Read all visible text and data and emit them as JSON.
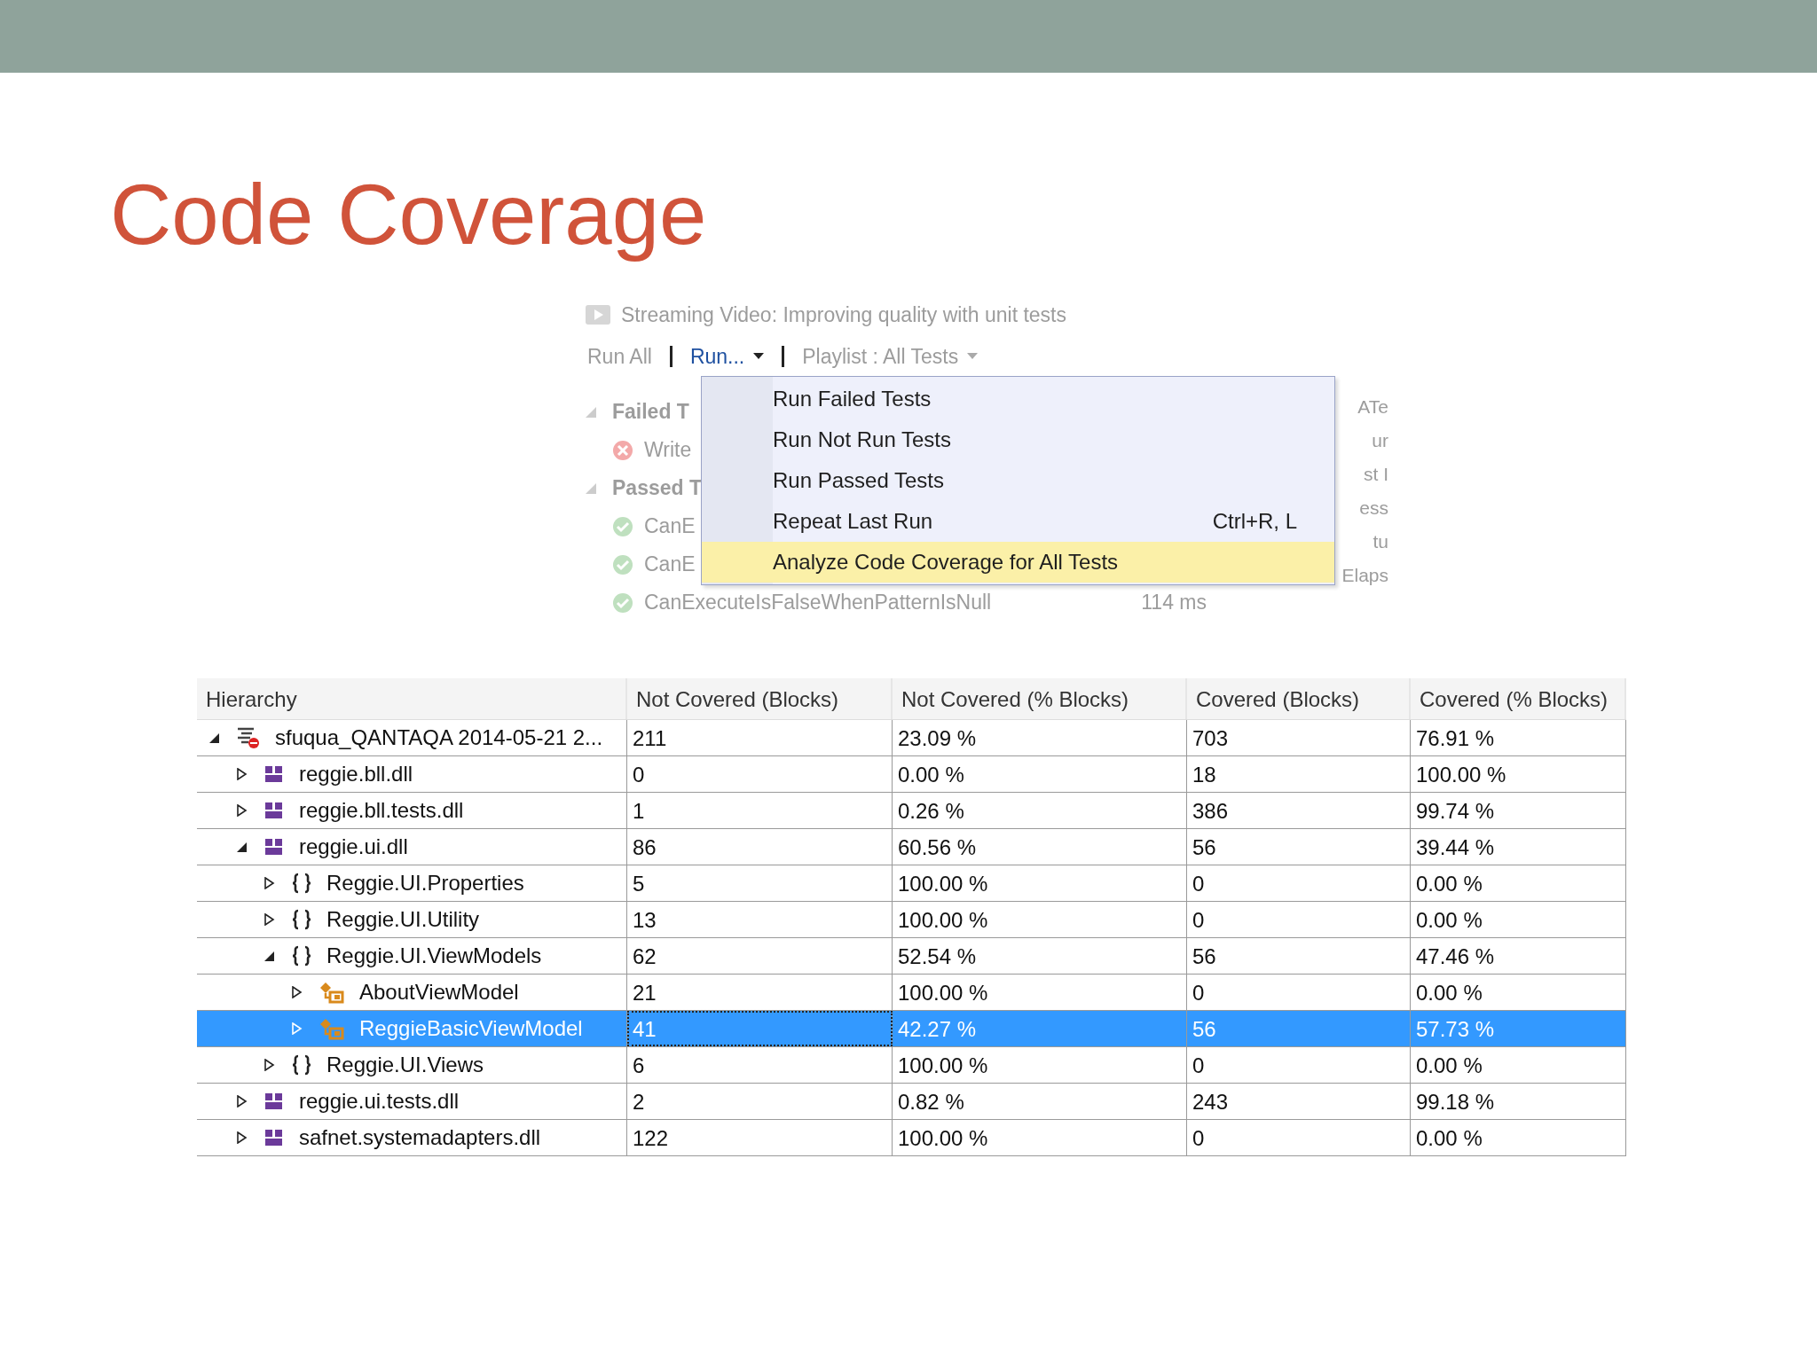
{
  "title": "Code Coverage",
  "test_explorer": {
    "video_title": "Streaming Video: Improving quality with unit tests",
    "toolbar": [
      {
        "label": "Run All",
        "kind": "faded"
      },
      {
        "label": "Run...",
        "kind": "dropdown-active"
      },
      {
        "label": "Playlist : All Tests",
        "kind": "dropdown-faded"
      }
    ],
    "tree": [
      {
        "label": "Failed T",
        "kind": "group"
      },
      {
        "label": "Write",
        "kind": "failed"
      },
      {
        "label": "Passed T",
        "kind": "group"
      },
      {
        "label": "CanE",
        "kind": "passed"
      },
      {
        "label": "CanE",
        "kind": "passed"
      },
      {
        "label": "CanExecuteIsFalseWhenPatternIsNull",
        "kind": "passed",
        "time": "114 ms"
      }
    ],
    "side_fragments": [
      "ATe",
      "ur",
      "st I",
      "ess",
      "tu",
      "Elaps"
    ]
  },
  "menu": {
    "items": [
      {
        "label": "Run Failed Tests",
        "selected": false
      },
      {
        "label": "Run Not Run Tests",
        "selected": false
      },
      {
        "label": "Run Passed Tests",
        "selected": false
      },
      {
        "label": "Repeat Last Run",
        "shortcut": "Ctrl+R, L",
        "selected": false
      },
      {
        "label": "Analyze Code Coverage for All Tests",
        "selected": true
      }
    ]
  },
  "coverage": {
    "columns": [
      "Hierarchy",
      "Not Covered (Blocks)",
      "Not Covered (% Blocks)",
      "Covered (Blocks)",
      "Covered (% Blocks)"
    ],
    "rows": [
      {
        "kind": "run",
        "name": "sfuqua_QANTAQA 2014-05-21 2...",
        "values": [
          "211",
          "23.09 %",
          "703",
          "76.91 %"
        ],
        "expanded": true,
        "selected": false,
        "children": [
          {
            "kind": "assembly",
            "name": "reggie.bll.dll",
            "values": [
              "0",
              "0.00 %",
              "18",
              "100.00 %"
            ],
            "expanded": false,
            "selected": false
          },
          {
            "kind": "assembly",
            "name": "reggie.bll.tests.dll",
            "values": [
              "1",
              "0.26 %",
              "386",
              "99.74 %"
            ],
            "expanded": false,
            "selected": false
          },
          {
            "kind": "assembly",
            "name": "reggie.ui.dll",
            "values": [
              "86",
              "60.56 %",
              "56",
              "39.44 %"
            ],
            "expanded": true,
            "selected": false,
            "children": [
              {
                "kind": "namespace",
                "name": "Reggie.UI.Properties",
                "values": [
                  "5",
                  "100.00 %",
                  "0",
                  "0.00 %"
                ],
                "expanded": false,
                "selected": false
              },
              {
                "kind": "namespace",
                "name": "Reggie.UI.Utility",
                "values": [
                  "13",
                  "100.00 %",
                  "0",
                  "0.00 %"
                ],
                "expanded": false,
                "selected": false
              },
              {
                "kind": "namespace",
                "name": "Reggie.UI.ViewModels",
                "values": [
                  "62",
                  "52.54 %",
                  "56",
                  "47.46 %"
                ],
                "expanded": true,
                "selected": false,
                "children": [
                  {
                    "kind": "class",
                    "name": "AboutViewModel",
                    "values": [
                      "21",
                      "100.00 %",
                      "0",
                      "0.00 %"
                    ],
                    "expanded": false,
                    "selected": false
                  },
                  {
                    "kind": "class",
                    "name": "ReggieBasicViewModel",
                    "values": [
                      "41",
                      "42.27 %",
                      "56",
                      "57.73 %"
                    ],
                    "expanded": false,
                    "selected": true
                  }
                ]
              },
              {
                "kind": "namespace",
                "name": "Reggie.UI.Views",
                "values": [
                  "6",
                  "100.00 %",
                  "0",
                  "0.00 %"
                ],
                "expanded": false,
                "selected": false
              }
            ]
          },
          {
            "kind": "assembly",
            "name": "reggie.ui.tests.dll",
            "values": [
              "2",
              "0.82 %",
              "243",
              "99.18 %"
            ],
            "expanded": false,
            "selected": false
          },
          {
            "kind": "assembly",
            "name": "safnet.systemadapters.dll",
            "values": [
              "122",
              "100.00 %",
              "0",
              "0.00 %"
            ],
            "expanded": false,
            "selected": false
          }
        ]
      }
    ]
  }
}
